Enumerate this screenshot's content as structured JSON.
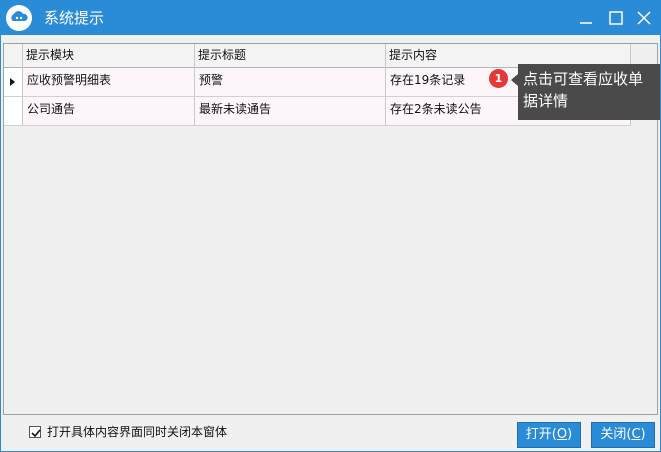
{
  "window": {
    "title": "系统提示",
    "accent_color": "#2a8bd6",
    "logo_icon": "cloud-app-logo-icon",
    "controls": [
      "minimize-icon",
      "maximize-icon",
      "close-icon"
    ]
  },
  "grid": {
    "columns": [
      "提示模块",
      "提示标题",
      "提示内容"
    ],
    "rows": [
      {
        "module": "应收预警明细表",
        "title": "预警",
        "content": "存在19条记录",
        "selected": true
      },
      {
        "module": "公司通告",
        "title": "最新未读通告",
        "content": "存在2条未读公告",
        "selected": false
      }
    ]
  },
  "tooltip": {
    "badge": "1",
    "text_line1": "点击可查看应收单",
    "text_line2": "据详情",
    "badge_color": "#e53935"
  },
  "footer": {
    "checkbox_checked": true,
    "checkbox_label": "打开具体内容界面同时关闭本窗体",
    "open_label": "打开(",
    "open_key": "O",
    "close_label": "关闭(",
    "close_key": "C",
    "paren_close": ")"
  }
}
